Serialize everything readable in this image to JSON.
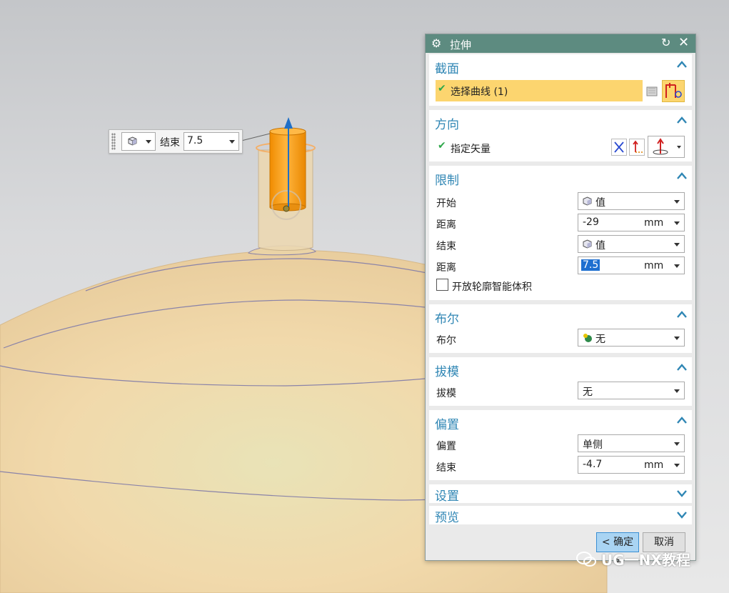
{
  "mini_toolbar": {
    "end_label": "结束",
    "end_value": "7.5"
  },
  "dialog": {
    "title": "拉伸",
    "sections": {
      "section": {
        "header": "截面",
        "select_curve_label": "选择曲线 (1)"
      },
      "direction": {
        "header": "方向",
        "vector_label": "指定矢量"
      },
      "limits": {
        "header": "限制",
        "start_label": "开始",
        "start_type": "值",
        "start_distance_label": "距离",
        "start_distance": "-29",
        "end_label": "结束",
        "end_type": "值",
        "end_distance_label": "距离",
        "end_distance": "7.5",
        "unit": "mm",
        "open_profile_label": "开放轮廓智能体积"
      },
      "boolean": {
        "header": "布尔",
        "label": "布尔",
        "value": "无"
      },
      "draft": {
        "header": "拔模",
        "label": "拔模",
        "value": "无"
      },
      "offset": {
        "header": "偏置",
        "label": "偏置",
        "value": "单侧",
        "end_label": "结束",
        "end_value": "-4.7",
        "unit": "mm"
      },
      "settings": {
        "header": "设置"
      },
      "preview": {
        "header": "预览"
      }
    },
    "buttons": {
      "ok": "< 确定 >",
      "cancel": "取消"
    }
  },
  "watermark": "UG一NX教程",
  "colors": {
    "accent": "#2f86b4",
    "titlebar": "#5d8b80",
    "highlight": "#fcd56f",
    "part": "#f2dcaf",
    "tube": "#f7a21a"
  }
}
